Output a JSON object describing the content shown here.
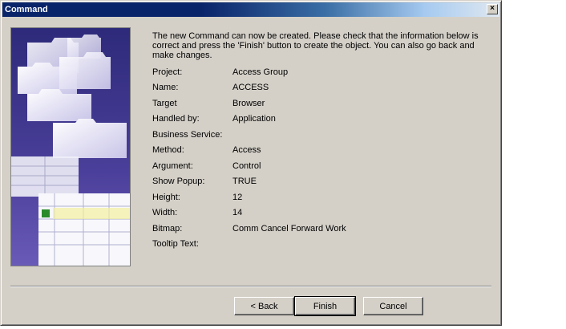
{
  "window": {
    "title": "Command",
    "close_glyph": "×"
  },
  "intro": "The new Command can now be created. Please check that the information below is correct and press the 'Finish' button to create the object. You can also go back and make changes.",
  "fields": [
    {
      "label": "Project:",
      "value": "Access Group"
    },
    {
      "label": "Name:",
      "value": "ACCESS"
    },
    {
      "label": "Target",
      "value": "Browser"
    },
    {
      "label": "Handled by:",
      "value": "Application"
    },
    {
      "label": "Business Service:",
      "value": ""
    },
    {
      "label": "Method:",
      "value": "Access"
    },
    {
      "label": "Argument:",
      "value": "Control"
    },
    {
      "label": "Show Popup:",
      "value": "TRUE"
    },
    {
      "label": "Height:",
      "value": "12"
    },
    {
      "label": "Width:",
      "value": "14"
    },
    {
      "label": "Bitmap:",
      "value": "Comm Cancel Forward Work"
    },
    {
      "label": "Tooltip Text:",
      "value": ""
    }
  ],
  "buttons": {
    "back": "< Back",
    "finish": "Finish",
    "cancel": "Cancel"
  },
  "colors": {
    "dialog_bg": "#d4d0c8",
    "title_active": "#0a246a",
    "image_bg": "#3a3488"
  },
  "icons": {
    "wizard_image": "folders-and-spreadsheet-illustration",
    "close": "close-icon"
  }
}
